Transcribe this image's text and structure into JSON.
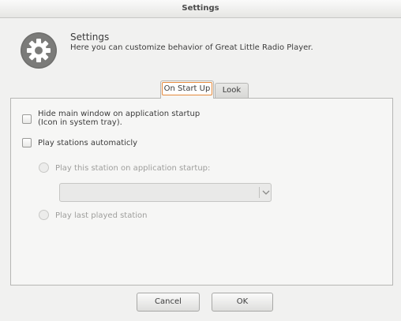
{
  "window": {
    "title": "Settings"
  },
  "header": {
    "title": "Settings",
    "description": "Here you can customize behavior of Great Little Radio Player.",
    "icon": "gear-icon"
  },
  "tabs": [
    {
      "label": "On Start Up",
      "active": true
    },
    {
      "label": "Look",
      "active": false
    }
  ],
  "options": {
    "hide_main_window": {
      "line1": "Hide main window on application startup",
      "line2": "(Icon in system tray).",
      "checked": false
    },
    "play_automatically": {
      "label": "Play stations automaticly",
      "checked": false
    },
    "play_this_station": {
      "label": "Play this station on application startup:",
      "selected": false,
      "enabled": false
    },
    "station_select": {
      "value": "",
      "enabled": false
    },
    "play_last": {
      "label": "Play last played station",
      "selected": false,
      "enabled": false
    }
  },
  "buttons": {
    "cancel": "Cancel",
    "ok": "OK"
  }
}
